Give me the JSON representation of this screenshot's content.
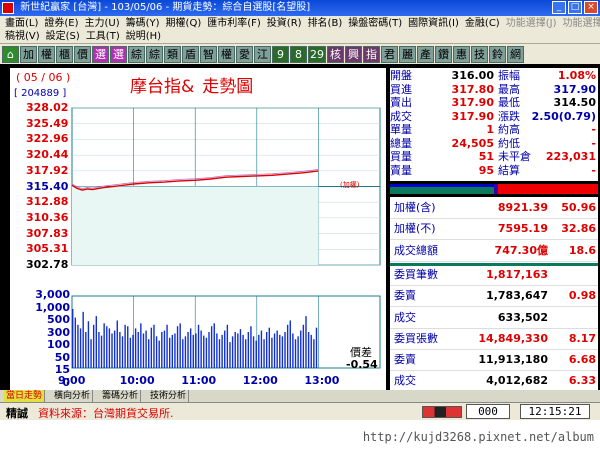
{
  "window": {
    "title": "新世紀贏家 [台灣] - 103/05/06 - 期貨走勢：綜合自選股[名望股]",
    "buttons": [
      "_",
      "□",
      "×"
    ]
  },
  "menu": {
    "row1": [
      "畫面(L)",
      "證券(E)",
      "主力(U)",
      "籌碼(Y)",
      "期權(Q)",
      "匯市利率(F)",
      "投資(R)",
      "排名(B)",
      "操盤密碼(T)",
      "國際資訊(I)",
      "金融(C)",
      "功能選擇(J)",
      "功能選擇(K)"
    ],
    "row2": [
      "稿視(V)",
      "設定(S)",
      "工具(T)",
      "說明(H)"
    ]
  },
  "toolbar": [
    "加",
    "權",
    "櫃",
    "價",
    "選",
    "選",
    "綜",
    "綜",
    "類",
    "盾",
    "智",
    "權",
    "愛",
    "江",
    "9",
    "8",
    "29",
    "核",
    "興",
    "指",
    "君",
    "麗",
    "產",
    "鑽",
    "惠",
    "技",
    "鈴",
    "網"
  ],
  "chart": {
    "date": "( 05 / 06 )",
    "code": "[ 204889 ]",
    "title_a": "摩台指&",
    "title_b": "走勢圖",
    "legend_small": "(加權)",
    "spread_label": "價差",
    "spread_value": "-0.54"
  },
  "chart_data": {
    "type": "line",
    "title": "摩台指& 走勢圖",
    "x_ticks": [
      "9:00",
      "10:00",
      "11:00",
      "12:00",
      "13:00"
    ],
    "price_ticks": [
      "328.02",
      "325.49",
      "322.96",
      "320.44",
      "317.92",
      "315.40",
      "312.88",
      "310.36",
      "307.83",
      "305.31",
      "302.78"
    ],
    "price_range": [
      302.78,
      328.02
    ],
    "reference_price": 315.4,
    "volume_ticks": [
      "3,000",
      "1,000",
      "500",
      "300",
      "100",
      "50",
      "15",
      "0"
    ],
    "series": [
      {
        "name": "摩台指",
        "x_minutes": [
          0,
          5,
          10,
          15,
          20,
          30,
          45,
          60,
          75,
          90,
          105,
          120,
          135,
          150,
          165,
          180,
          195,
          210,
          225,
          240
        ],
        "values": [
          315.6,
          315.1,
          314.8,
          315.0,
          314.9,
          315.2,
          315.5,
          315.8,
          316.0,
          316.1,
          316.3,
          316.4,
          316.6,
          316.9,
          317.0,
          317.1,
          317.2,
          317.4,
          317.6,
          317.9
        ]
      }
    ],
    "volume_rel": [
      0.82,
      0.7,
      0.6,
      0.55,
      0.78,
      0.5,
      0.65,
      0.4,
      0.6,
      0.72,
      0.5,
      0.45,
      0.62,
      0.58,
      0.55,
      0.48,
      0.52,
      0.66,
      0.5,
      0.44,
      0.6,
      0.58,
      0.42,
      0.46,
      0.55,
      0.5,
      0.62,
      0.48,
      0.52,
      0.4,
      0.56,
      0.6,
      0.44,
      0.38,
      0.5,
      0.52,
      0.6,
      0.42,
      0.46,
      0.48,
      0.58,
      0.62,
      0.4,
      0.44,
      0.5,
      0.55,
      0.46,
      0.48,
      0.6,
      0.52,
      0.45,
      0.42,
      0.5,
      0.58,
      0.62,
      0.48,
      0.4,
      0.46,
      0.52,
      0.6,
      0.36,
      0.44,
      0.5,
      0.48,
      0.54,
      0.46,
      0.4,
      0.5,
      0.58,
      0.44,
      0.38,
      0.46,
      0.52,
      0.4,
      0.5,
      0.56,
      0.42,
      0.48,
      0.52,
      0.46,
      0.44,
      0.5,
      0.6,
      0.66,
      0.48,
      0.4,
      0.44,
      0.52,
      0.6,
      0.72,
      0.5,
      0.46,
      0.4,
      0.56
    ]
  },
  "quote": {
    "left": [
      {
        "label": "開盤",
        "value": "316.00",
        "cls": "black"
      },
      {
        "label": "買進",
        "value": "317.80",
        "cls": "red"
      },
      {
        "label": "賣出",
        "value": "317.90",
        "cls": "red"
      },
      {
        "label": "成交",
        "value": "317.90",
        "cls": "red"
      },
      {
        "label": "單量",
        "value": "1",
        "cls": "red"
      },
      {
        "label": "總量",
        "value": "24,505",
        "cls": "red"
      },
      {
        "label": "買量",
        "value": "51",
        "cls": "red"
      },
      {
        "label": "賣量",
        "value": "95",
        "cls": "red"
      }
    ],
    "right": [
      {
        "label": "振幅",
        "value": "1.08%",
        "cls": "red"
      },
      {
        "label": "最高",
        "value": "317.90",
        "cls": "blue"
      },
      {
        "label": "最低",
        "value": "314.50",
        "cls": "black"
      },
      {
        "label": "漲跌",
        "value": "2.50(0.79)",
        "cls": "blue"
      },
      {
        "label": "約高",
        "value": "-",
        "cls": "red"
      },
      {
        "label": "約低",
        "value": "-",
        "cls": "red"
      },
      {
        "label": "未平倉",
        "value": "223,031",
        "cls": "red"
      },
      {
        "label": "結算",
        "value": "-",
        "cls": "red"
      }
    ]
  },
  "stats": [
    {
      "label": "加權(含)",
      "value": "8921.39",
      "pct": "50.96"
    },
    {
      "label": "加權(不)",
      "value": "7595.19",
      "pct": "32.86"
    },
    {
      "label": "成交總額",
      "value": "747.30億",
      "pct": "18.6"
    },
    {
      "label": "委買筆數",
      "value": "1,817,163",
      "pct": ""
    },
    {
      "label": "委賣",
      "value": "1,783,647",
      "pct": "0.98"
    },
    {
      "label": "成交",
      "value": "633,502",
      "pct": ""
    },
    {
      "label": "委買張數",
      "value": "14,849,330",
      "pct": "8.17"
    },
    {
      "label": "委賣",
      "value": "11,913,180",
      "pct": "6.68"
    },
    {
      "label": "成交",
      "value": "4,012,682",
      "pct": "6.33"
    }
  ],
  "tabs": [
    "當日走勢",
    "橫向分析",
    "籌碼分析",
    "技術分析"
  ],
  "status": {
    "left": "精誠",
    "message": "資料來源：台灣期貨交易所.",
    "count": "000",
    "time": "12:15:21"
  },
  "footer": {
    "url": "http://kujd3268.pixnet.net/album"
  }
}
